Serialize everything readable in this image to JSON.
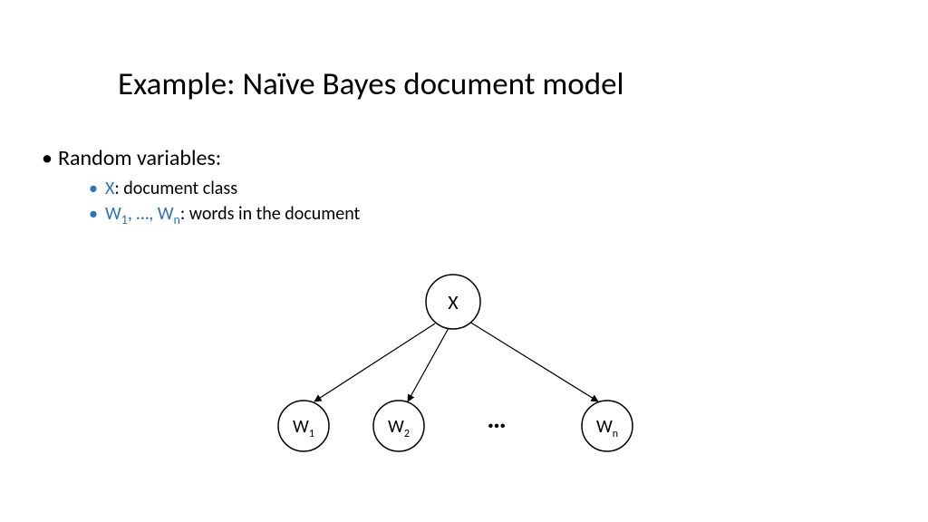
{
  "title": "Example: Naïve Bayes document model",
  "bullets": {
    "heading": "Random variables:",
    "sub1_var": "X",
    "sub1_rest": ": document class",
    "sub2_var_pre": "W",
    "sub2_var_s1": "1",
    "sub2_var_mid": ", …, W",
    "sub2_var_s2": "n",
    "sub2_rest": ": words in the document"
  },
  "diagram": {
    "root": "X",
    "leaf1_base": "W",
    "leaf1_sub": "1",
    "leaf2_base": "W",
    "leaf2_sub": "2",
    "leaf3_base": "W",
    "leaf3_sub": "n",
    "ellipsis": "…"
  }
}
